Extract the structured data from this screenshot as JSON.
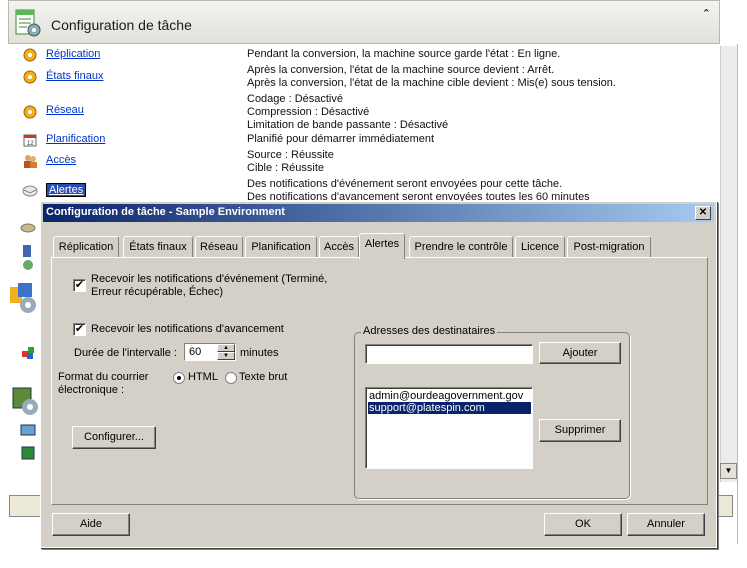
{
  "background_window": {
    "title": "Configuration de tâche",
    "collapse_glyph": "⌃",
    "summary": [
      {
        "link": "Réplication",
        "desc": [
          "Pendant la conversion, la machine source garde l'état : En ligne."
        ]
      },
      {
        "link": "États finaux",
        "desc": [
          "Après la conversion, l'état de la machine source devient : Arrêt.",
          "Après la conversion, l'état de la machine cible devient : Mis(e) sous tension."
        ]
      },
      {
        "link": "Réseau",
        "desc": [
          "Codage : Désactivé",
          "Compression : Désactivé",
          "Limitation de bande passante : Désactivé"
        ]
      },
      {
        "link": "Planification",
        "desc": [
          "Planifié pour démarrer immédiatement"
        ]
      },
      {
        "link": "Accès",
        "desc": [
          "Source : Réussite",
          "Cible : Réussite"
        ]
      },
      {
        "link": "Alertes",
        "desc": [
          "Des notifications d'événement seront envoyées pour cette tâche.",
          "Des notifications d'avancement seront envoyées toutes les 60 minutes"
        ]
      }
    ]
  },
  "dialog": {
    "title": "Configuration de tâche - Sample Environment",
    "close_glyph": "✕",
    "tabs": [
      "Réplication",
      "États finaux",
      "Réseau",
      "Planification",
      "Accès",
      "Alertes",
      "Prendre le contrôle",
      "Licence",
      "Post-migration"
    ],
    "active_tab": "Alertes",
    "alerts": {
      "event_notif_checked": true,
      "event_notif_label_line1": "Recevoir les notifications d'événement (Terminé,",
      "event_notif_label_line2": "Erreur récupérable, Échec)",
      "progress_notif_checked": true,
      "progress_notif_label": "Recevoir les notifications d'avancement",
      "interval_label": "Durée de l'intervalle :",
      "interval_value": "60",
      "interval_unit": "minutes",
      "email_format_label_line1": "Format du courrier",
      "email_format_label_line2": "électronique :",
      "format_options": [
        "HTML",
        "Texte brut"
      ],
      "selected_format": "HTML",
      "configure_button": "Configurer...",
      "recipients_group_label": "Adresses des destinataires",
      "address_input_value": "",
      "add_button": "Ajouter",
      "recipients": [
        "admin@ourdeagovernment.gov",
        "support@platespin.com"
      ],
      "selected_recipient": "support@platespin.com",
      "remove_button": "Supprimer"
    },
    "help_button": "Aide",
    "ok_button": "OK",
    "cancel_button": "Annuler"
  },
  "colors": {
    "dialog_title_start": "#0a246a",
    "dialog_title_end": "#a6caf0",
    "link": "#0033cc",
    "selection": "#0a246a",
    "face": "#d4d0c8"
  }
}
